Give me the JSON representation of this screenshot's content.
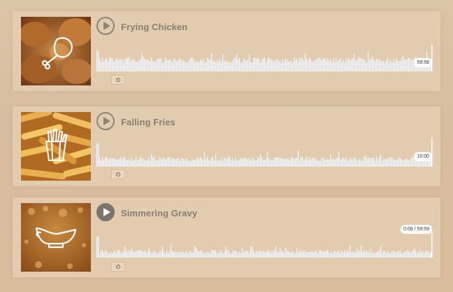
{
  "tracks": [
    {
      "title": "Frying Chicken",
      "time": "59:58",
      "icon": "chicken-leg-icon",
      "photo": "fried-chicken-photo",
      "playing": false,
      "colors": {
        "photo_base": "#8a4a1e",
        "photo_light": "#c98a45"
      }
    },
    {
      "title": "Falling Fries",
      "time": "10:00",
      "icon": "fries-icon",
      "photo": "french-fries-photo",
      "playing": false,
      "colors": {
        "photo_base": "#c8822a",
        "photo_light": "#f0c060"
      }
    },
    {
      "title": "Simmering Gravy",
      "time": "0:08 / 59:59",
      "icon": "gravy-boat-icon",
      "photo": "gravy-photo",
      "playing": true,
      "colors": {
        "photo_base": "#9a5a1e",
        "photo_light": "#c98a40"
      }
    }
  ],
  "colors": {
    "panel": "#e2cbae",
    "wave": "#ffffff",
    "title": "#8a7f73"
  }
}
